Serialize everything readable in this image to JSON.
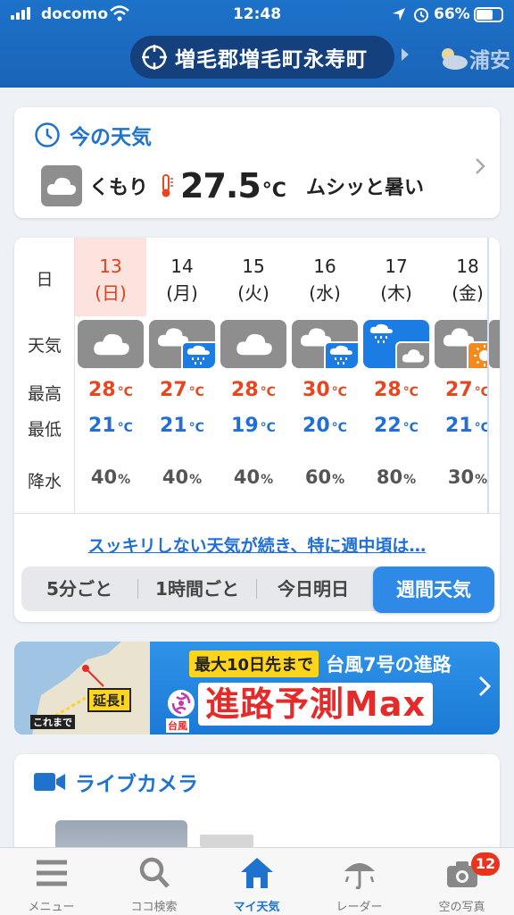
{
  "status_bar": {
    "carrier": "docomo",
    "time": "12:48",
    "battery": "66%",
    "battery_level": 0.66
  },
  "header": {
    "location": "増毛郡増毛町永寿町",
    "next_location": "浦安"
  },
  "current": {
    "title": "今の天気",
    "condition": "くもり",
    "temperature": "27.5",
    "unit": "°C",
    "feel": "ムシッと暑い",
    "icon": "cloud-icon"
  },
  "forecast": {
    "row_labels": {
      "day": "日",
      "weather": "天気",
      "high": "最高",
      "low": "最低",
      "precip": "降水"
    },
    "temp_unit": "°C",
    "precip_unit": "%",
    "days": [
      {
        "date": "13",
        "weekday": "(日)",
        "icon": "cloudy",
        "high": "28",
        "low": "21",
        "precip": "40"
      },
      {
        "date": "14",
        "weekday": "(月)",
        "icon": "cloudy-then-rain",
        "high": "27",
        "low": "21",
        "precip": "40"
      },
      {
        "date": "15",
        "weekday": "(火)",
        "icon": "cloudy",
        "high": "28",
        "low": "19",
        "precip": "40"
      },
      {
        "date": "16",
        "weekday": "(水)",
        "icon": "cloudy-then-rain",
        "high": "30",
        "low": "20",
        "precip": "60"
      },
      {
        "date": "17",
        "weekday": "(木)",
        "icon": "rain-then-cloudy",
        "high": "28",
        "low": "22",
        "precip": "80"
      },
      {
        "date": "18",
        "weekday": "(金)",
        "icon": "cloudy-then-sunny",
        "high": "27",
        "low": "21",
        "precip": "30"
      }
    ],
    "commentary_link": "スッキリしない天気が続き、特に週中頃は…",
    "tabs": [
      "5分ごと",
      "1時間ごと",
      "今日明日",
      "週間天気"
    ]
  },
  "banner": {
    "highlight": "最大10日先まで",
    "subtitle": "台風7号の進路",
    "title": "進路予測Max",
    "badge": "台風",
    "map_label": "延長!",
    "map_caption": "これまで"
  },
  "live_camera": {
    "title": "ライブカメラ"
  },
  "tabbar": {
    "items": [
      {
        "label": "メニュー",
        "icon": "menu-icon"
      },
      {
        "label": "ココ検索",
        "icon": "search-icon"
      },
      {
        "label": "マイ天気",
        "icon": "home-icon"
      },
      {
        "label": "レーダー",
        "icon": "radar-umbrella-icon"
      },
      {
        "label": "空の写真",
        "icon": "camera-icon"
      }
    ],
    "badge_count": "12"
  },
  "colors": {
    "brand_blue": "#1d72c9",
    "high_temp": "#e8461e",
    "low_temp": "#1f6fd6",
    "sunday": "#e0401e"
  }
}
